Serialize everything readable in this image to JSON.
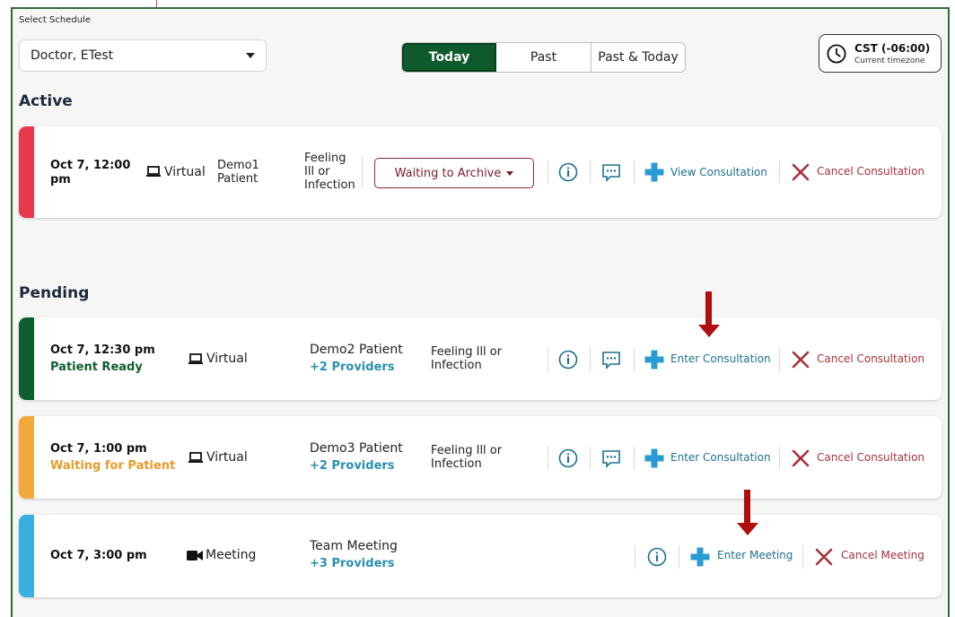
{
  "header": {
    "select_label": "Select Schedule",
    "schedule_value": "Doctor, ETest",
    "tabs": [
      "Today",
      "Past",
      "Past & Today"
    ],
    "active_tab": "Today",
    "timezone": "CST (-06:00)",
    "timezone_sub": "Current timezone"
  },
  "sections": {
    "active": "Active",
    "pending": "Pending"
  },
  "colors": {
    "brand_green": "#0e5a2c",
    "active_red": "#e8394a",
    "ready_green": "#0f5e2e",
    "waiting_orange": "#f2a83a",
    "meeting_blue": "#3aaee0"
  },
  "active_item": {
    "date": "Oct 7, 12:00",
    "date2": "pm",
    "mode": "Virtual",
    "patient_l1": "Demo1",
    "patient_l2": "Patient",
    "reason_l1": "Feeling",
    "reason_l2": "Ill or",
    "reason_l3": "Infection",
    "status_button": "Waiting to Archive",
    "primary_action": "View Consultation",
    "cancel_action": "Cancel Consultation"
  },
  "pending": [
    {
      "date": "Oct 7, 12:30 pm",
      "status": "Patient Ready",
      "mode": "Virtual",
      "name": "Demo2 Patient",
      "providers": "+2 Providers",
      "reason_l1": "Feeling Ill or",
      "reason_l2": "Infection",
      "primary_action": "Enter Consultation",
      "cancel_action": "Cancel Consultation"
    },
    {
      "date": "Oct 7, 1:00 pm",
      "status": "Waiting for Patient",
      "mode": "Virtual",
      "name": "Demo3 Patient",
      "providers": "+2 Providers",
      "reason_l1": "Feeling Ill or",
      "reason_l2": "Infection",
      "primary_action": "Enter Consultation",
      "cancel_action": "Cancel Consultation"
    },
    {
      "date": "Oct 7, 3:00 pm",
      "status": "",
      "mode": "Meeting",
      "name": "Team Meeting",
      "providers": "+3 Providers",
      "primary_action": "Enter Meeting",
      "cancel_action": "Cancel Meeting"
    }
  ]
}
